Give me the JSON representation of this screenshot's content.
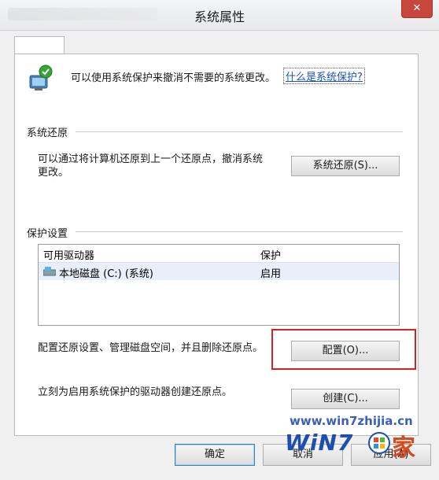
{
  "window": {
    "title": "系统属性",
    "close_glyph": "✕"
  },
  "intro": {
    "text": "可以使用系统保护来撤消不需要的系统更改。",
    "link": "什么是系统保护?"
  },
  "restore": {
    "heading": "系统还原",
    "desc_line1": "可以通过将计算机还原到上一个还原点，撤消系统",
    "desc_line2": "更改。",
    "button": "系统还原(S)..."
  },
  "protection": {
    "heading": "保护设置",
    "columns": [
      "可用驱动器",
      "保护"
    ],
    "rows": [
      {
        "drive": "本地磁盘 (C:) (系统)",
        "status": "启用"
      }
    ],
    "configure_desc": "配置还原设置、管理磁盘空间，并且删除还原点。",
    "configure_button": "配置(O)...",
    "create_desc": "立刻为启用系统保护的驱动器创建还原点。",
    "create_button": "创建(C)..."
  },
  "footer": {
    "ok": "确定",
    "cancel": "取消",
    "apply": "应用(A)"
  },
  "watermark": {
    "site": "www.win7zhijia.cn",
    "logo": "WiN7",
    "home": "家"
  },
  "colors": {
    "accent_link": "#1c52c2",
    "highlight": "#d92020",
    "close": "#c7463d"
  },
  "icons": [
    "system-protection-shield-icon",
    "drive-icon",
    "close-icon"
  ]
}
